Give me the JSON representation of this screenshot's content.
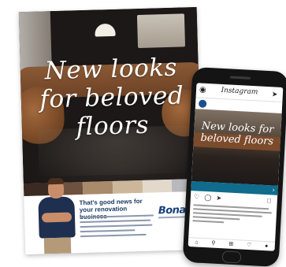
{
  "flyer": {
    "headline": "New looks for beloved floors",
    "tagline": "That's good news for your renovation business",
    "logo": "Bona",
    "swatch_colors": [
      "#3b2a22",
      "#6f5140",
      "#a98a6a",
      "#cdb79b",
      "#e2d8cb",
      "#b9b9bd"
    ]
  },
  "phone": {
    "app_title": "Instagram",
    "headline": "New looks for beloved floors",
    "icons": {
      "camera": "camera-icon",
      "send": "send-icon",
      "like": "heart-icon",
      "comment": "comment-icon",
      "share": "share-icon",
      "save": "bookmark-icon",
      "home": "home-icon",
      "search": "search-icon",
      "add": "add-icon",
      "activity": "activity-icon",
      "profile": "profile-icon"
    }
  },
  "colors": {
    "brand_blue": "#16407a",
    "ig_cta_bar": "#0f6c8c"
  }
}
